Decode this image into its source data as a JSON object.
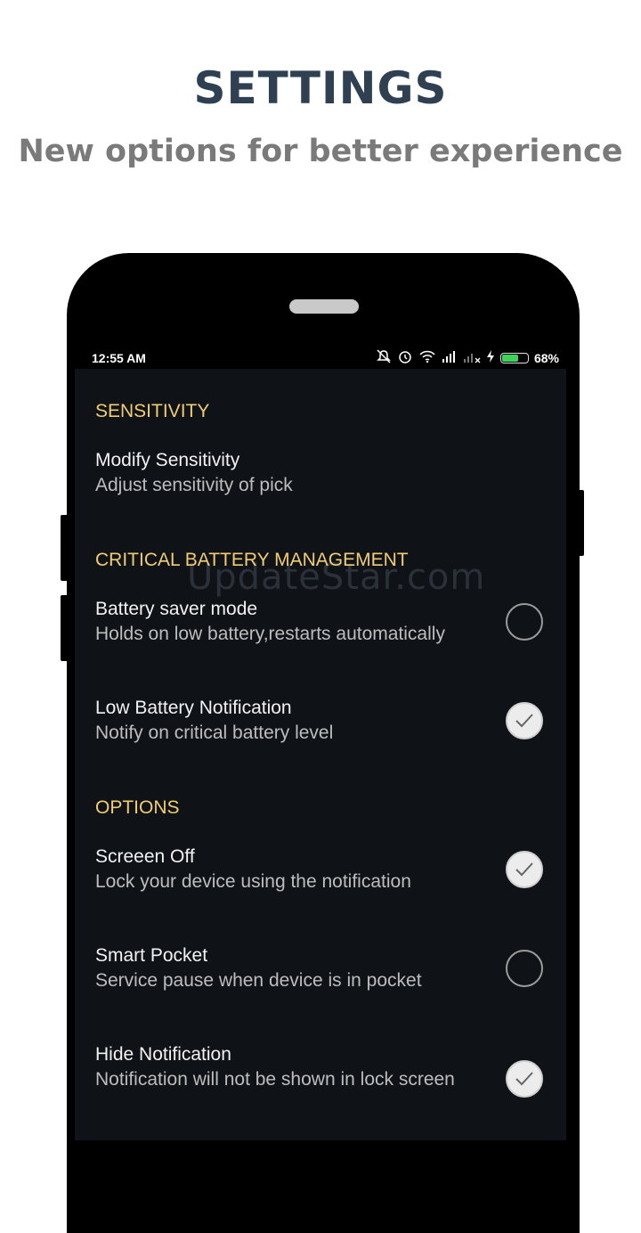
{
  "promo": {
    "title": "SETTINGS",
    "subtitle": "New options for better experience"
  },
  "status_bar": {
    "time": "12:55 AM",
    "battery_percent": "68%",
    "battery_level": 0.68,
    "icons": [
      "mute-icon",
      "alarm-icon",
      "wifi-icon",
      "signal-icon",
      "signal-no-service-icon",
      "charging-icon",
      "battery-icon"
    ]
  },
  "watermark": "UpdateStar.com",
  "sections": {
    "sensitivity": "SENSITIVITY",
    "battery": "CRITICAL BATTERY MANAGEMENT",
    "options": "OPTIONS"
  },
  "prefs": {
    "modify_sensitivity": {
      "title": "Modify Sensitivity",
      "summary": "Adjust sensitivity of pick"
    },
    "battery_saver": {
      "title": "Battery saver mode",
      "summary": "Holds on low battery,restarts automatically",
      "checked": false
    },
    "low_battery": {
      "title": "Low Battery Notification",
      "summary": "Notify on critical battery level",
      "checked": true
    },
    "screen_off": {
      "title": "Screeen Off",
      "summary": "Lock your device using the notification",
      "checked": true
    },
    "smart_pocket": {
      "title": "Smart Pocket",
      "summary": "Service pause when device is in pocket",
      "checked": false
    },
    "hide_notification": {
      "title": "Hide Notification",
      "summary": "Notification will not be shown in lock screen",
      "checked": true
    }
  },
  "colors": {
    "accent": "#f0cd73",
    "screen_bg": "#0f1216",
    "title": "#2f4052"
  }
}
